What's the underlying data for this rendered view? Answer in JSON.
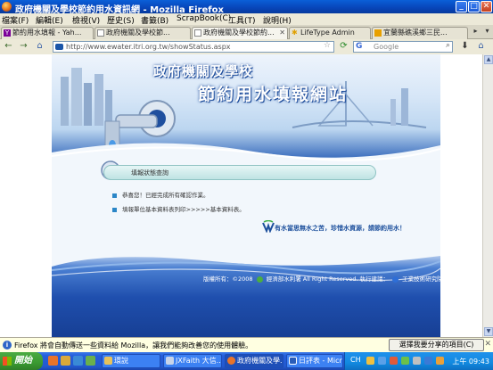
{
  "window": {
    "title": "政府機關及學校節約用水資訊網 - Mozilla Firefox"
  },
  "menu": [
    "檔案(F)",
    "編輯(E)",
    "檢視(V)",
    "歷史(S)",
    "書籤(B)",
    "ScrapBook(C)",
    "工具(T)",
    "說明(H)"
  ],
  "tabs": [
    {
      "label": "節約用水填報 - Yah..."
    },
    {
      "label": "政府機關及學校節..."
    },
    {
      "label": "政府機關及學校節約..."
    },
    {
      "label": "LifeType Admin"
    },
    {
      "label": "宜蘭縣礁溪鄉三民..."
    }
  ],
  "nav": {
    "url": "http://www.ewater.itri.org.tw/showStatus.aspx",
    "search_placeholder": "Google",
    "search_engine_icon": "G"
  },
  "page": {
    "banner_line1": "政府機關及學校",
    "banner_line2": "節約用水填報網站",
    "status_label": "填報狀態查詢",
    "messages": [
      "恭喜您！已經完成所有確認作業。",
      "填報單位基本資料表列印>>>>>基本資料表。"
    ],
    "slogan": "有水當思無水之苦，珍惜水資源，請節約用水！",
    "footer": {
      "copyright": "版權所有：©2008",
      "org": "經濟部水利署",
      "rights": "All Right Reserved. 執行建議：",
      "exec": "工業技術研究院"
    }
  },
  "notification": {
    "message": "Firefox 將會自動傳送一些資料給 Mozilla，讓我們能夠改善您的使用體驗。",
    "button": "選擇我要分享的項目(C)",
    "close": "✕"
  },
  "taskbar": {
    "start": "開始",
    "tasks": [
      {
        "label": "環說"
      },
      {
        "label": "JXFaith 大信..."
      },
      {
        "label": "政府機關及學..."
      },
      {
        "label": "日評表 - Micro..."
      }
    ],
    "lang": "CH",
    "clock": "上午 09:43"
  },
  "colors": {
    "titlebar": "#0845b8",
    "taskbar": "#245edb",
    "start": "#3a9a31",
    "banner_blue": "#2d62b8"
  }
}
